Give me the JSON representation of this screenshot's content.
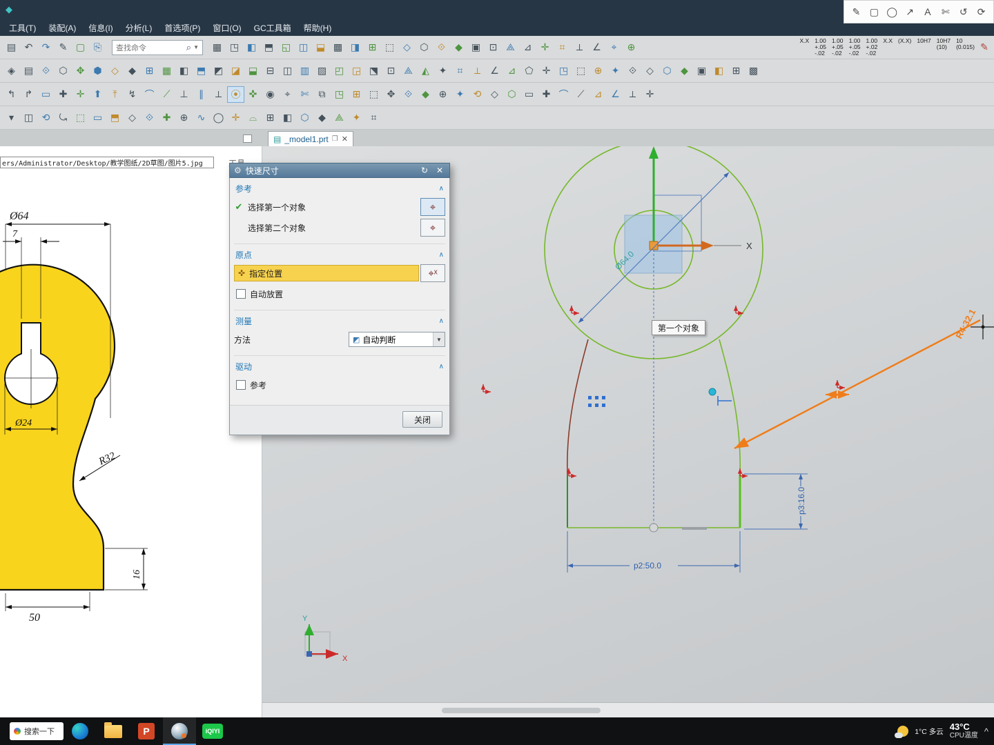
{
  "annot_bar": {
    "icons": [
      "✎",
      "▢",
      "◯",
      "↗",
      "A",
      "✄",
      "↺",
      "⟳"
    ]
  },
  "menubar": {
    "items": [
      "工具(T)",
      "装配(A)",
      "信息(I)",
      "分析(L)",
      "首选项(P)",
      "窗口(O)",
      "GC工具箱",
      "帮助(H)"
    ]
  },
  "toolbars": {
    "find_placeholder": "查找命令",
    "row1_left": "▤↶↷✎▢⎘",
    "row1_right": "▦◳◧⬒◱◫⬓▩◨⊞⬚◇⬡⟐◆▣⊡⟁⊿✛⌗⟂∠⌖⊕",
    "tolerances": [
      "X.X",
      "1.00\n+.05\n-.02",
      "1.00\n+.05\n-.02",
      "1.00\n+.05\n-.02",
      "1.00\n+.02\n-.02",
      "X.X",
      "(X.X)",
      "10H7",
      "10H7\n(10)",
      "10\n(0.015)"
    ],
    "row1_tail": "✎",
    "row2": "◈▤⟐⬡✥⬢◇◆⊞▦◧⬒◩◪⬓⊟◫▥▨◰◲⬔⊡⟁◭✦⌗⟂∠⊿⬠✛◳⬚⊕✦⟐◇⬡◆▣◧⊞▩",
    "row3": "↰↱▭✚✛⬆⤒↯⌒⟋⊥∥⟂⦿✜◉⌖✄⧉◳⊞⬚✥⟐◆⊕✦⟲◇⬡▭✚⌒⟋⊿∠⟂✛",
    "row4": "▾◫⟲⤿⬚▭⬒◇⟐✚⊕∿◯✛⌓⊞◧⬡◆⟁✦⌗"
  },
  "tab": {
    "icon": "▤",
    "label": "_model1.prt",
    "aux": "❐",
    "close": "✕"
  },
  "left_panel": {
    "path": "ers/Administrator/Desktop/教学图纸/2D草图/图片5.jpg",
    "tool_label": "工具",
    "dims": {
      "d64": "Ø64",
      "w7": "7",
      "d24": "Ø24",
      "r32": "R32",
      "h16": "16",
      "w50": "50"
    }
  },
  "dialog": {
    "title": "快速尺寸",
    "icons": {
      "gear": "⚙",
      "reset": "↻",
      "close": "✕",
      "check": "✔",
      "pick": "⌖",
      "pick_alt": "⌖ˣ",
      "pointer": "✜",
      "chevron": "∧",
      "method": "◩",
      "caret": "▼"
    },
    "sections": {
      "reference": "参考",
      "origin": "原点",
      "measure": "测量",
      "drive": "驱动"
    },
    "rows": {
      "select_first": "选择第一个对象",
      "select_second": "选择第二个对象",
      "specify": "指定位置",
      "auto_place": "自动放置",
      "method_label": "方法",
      "method_value": "自动判断",
      "drive_ref": "参考",
      "close_btn": "关闭"
    }
  },
  "canvas": {
    "tooltip": "第一个对象",
    "dim_p2": "p2:50.0",
    "dim_p3": "p3:16.0",
    "dim_diag": "Ø64.0",
    "dim_orange": "R4:32.1",
    "axis_x": "X",
    "wcs_x": "X",
    "wcs_y": "Y"
  },
  "taskbar": {
    "search": "搜索一下",
    "ppt": "P",
    "iqiyi": "iQIYI",
    "weather": "1°C 多云",
    "cpu_temp": "43°C",
    "cpu_label": "CPU温度",
    "caret": "^"
  }
}
